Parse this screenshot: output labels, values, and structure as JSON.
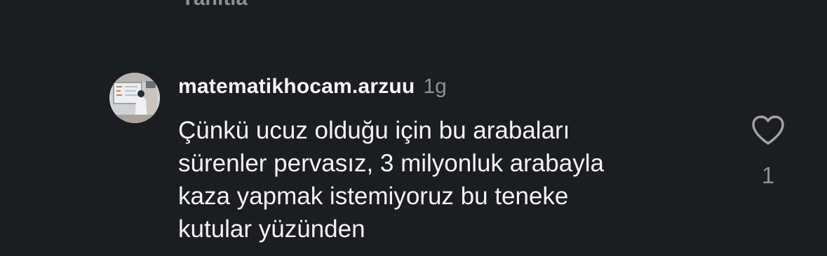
{
  "previous_reply": {
    "reply_label": "Yanıtla"
  },
  "comment": {
    "username": "matematikhocam.arzuu",
    "time": "1g",
    "text_lines": [
      "Çünkü ucuz olduğu için bu arabaları",
      "sürenler pervasız, 3 milyonluk arabayla",
      "kaza yapmak istemiyoruz bu teneke",
      "kutular yüzünden"
    ],
    "like_icon": "heart-outline-icon",
    "like_count": "1"
  },
  "colors": {
    "background": "#1c1d21",
    "primary_text": "#f3f4f6",
    "secondary_text": "#8e9096"
  }
}
